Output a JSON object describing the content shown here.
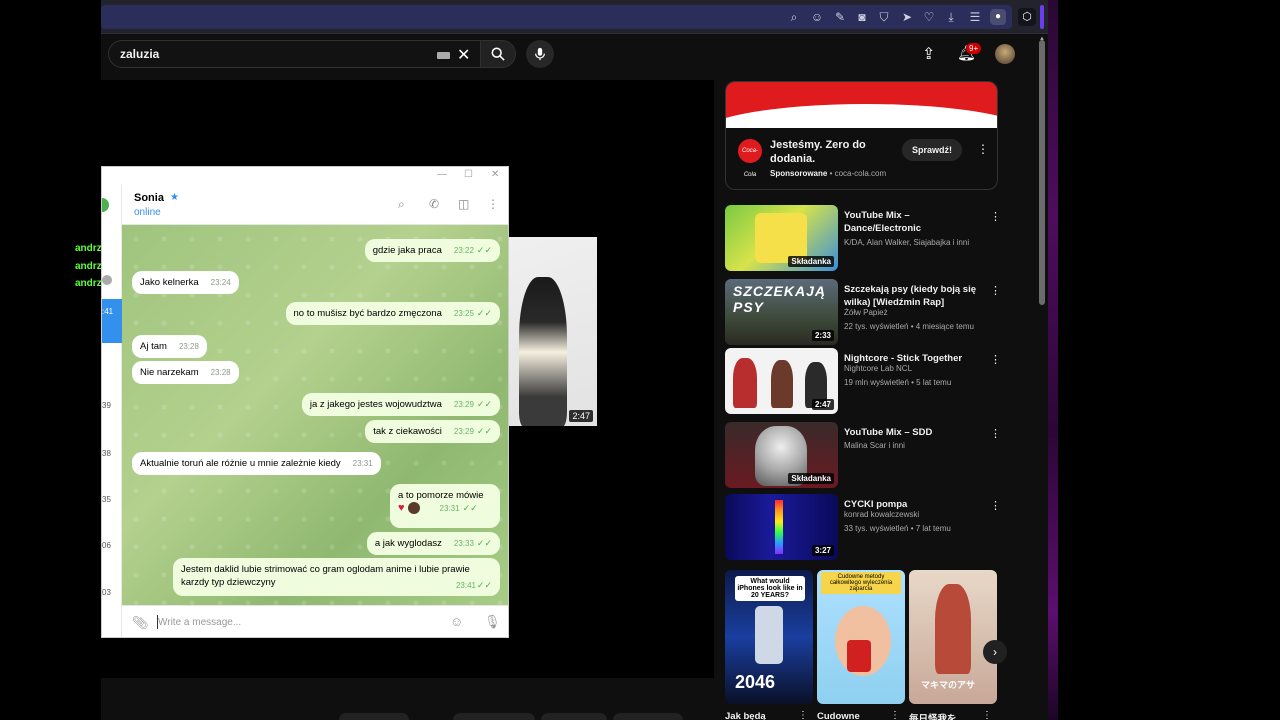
{
  "search": {
    "query": "zaluzia"
  },
  "notifications": {
    "badge": "9+"
  },
  "ad": {
    "logo_text": "Coca-Cola",
    "title": "Jesteśmy. Zero do dodania.",
    "sponsored_label": "Sponsorowane",
    "domain": "coca-cola.com",
    "cta": "Sprawdź!"
  },
  "pip": {
    "duration": "2:47"
  },
  "recommendations": [
    {
      "title": "YouTube Mix – Dance/Electronic",
      "meta1": "K/DA, Alan Walker, Siajabajka i inni",
      "meta2": "",
      "badge": "Składanka"
    },
    {
      "title": "Szczekają psy (kiedy boją się wilka) [Wiedźmin Rap]",
      "meta1": "Żółw Papież",
      "meta2": "22 tys. wyświetleń • 4 miesiące temu",
      "badge": "2:33"
    },
    {
      "title": "Nightcore - Stick Together",
      "meta1": "Nightcore Lab NCL",
      "meta2": "19 mln wyświetleń • 5 lat temu",
      "badge": "2:47"
    },
    {
      "title": "YouTube Mix – SDD",
      "meta1": "Malina Scar i inni",
      "meta2": "",
      "badge": "Składanka"
    },
    {
      "title": "CYCKI pompa",
      "meta1": "konrad kowalczewski",
      "meta2": "33 tys. wyświetleń • 7 lat temu",
      "badge": "3:27"
    }
  ],
  "thumb_texts": {
    "szczekaja": "SZCZEKAJĄ PSY"
  },
  "shorts": [
    {
      "caption": "Jak będą",
      "overlay": "What would iPhones look like in 20 YEARS?",
      "big": "2046"
    },
    {
      "caption": "Cudowne",
      "overlay": "Cudowne metody całkowitego wyleczenia zaparcia",
      "big": ""
    },
    {
      "caption": "毎日怪我を",
      "overlay": "",
      "big": "マキマのアサ"
    }
  ],
  "telegram": {
    "contact_name": "Sonia",
    "status": "online",
    "input_placeholder": "Write a message...",
    "messages": [
      {
        "dir": "out",
        "text": "gdzie jaka praca",
        "time": "23:22"
      },
      {
        "dir": "in",
        "text": "Jako kelnerka",
        "time": "23:24"
      },
      {
        "dir": "out",
        "text": "no to mušisz być bardzo zmęczona",
        "time": "23:25"
      },
      {
        "dir": "in",
        "text": "Aj tam",
        "time": "23:28"
      },
      {
        "dir": "in",
        "text": "Nie narzekam",
        "time": "23:28"
      },
      {
        "dir": "out",
        "text": "ja z jakego jestes wojowudztwa",
        "time": "23:29"
      },
      {
        "dir": "out",
        "text": "tak z ciekawości",
        "time": "23:29"
      },
      {
        "dir": "in",
        "text": "Aktualnie toruń ale różnie u mnie zależnie kiedy",
        "time": "23:31"
      },
      {
        "dir": "out",
        "text": "a to pomorze mówie",
        "time": "23:31"
      },
      {
        "dir": "out",
        "text": "a jak wyglodasz",
        "time": "23:33"
      },
      {
        "dir": "out",
        "text": "Jestem daklid lubie strimować  co gram  oglodam anime i lubie prawie karzdy typ dziewczyny",
        "time": "23:41"
      }
    ]
  },
  "left_labels": [
    "andrz",
    "andrz",
    "andrz"
  ],
  "sidebar_times": [
    ":41",
    "39",
    "38",
    "35",
    "06",
    "03"
  ]
}
